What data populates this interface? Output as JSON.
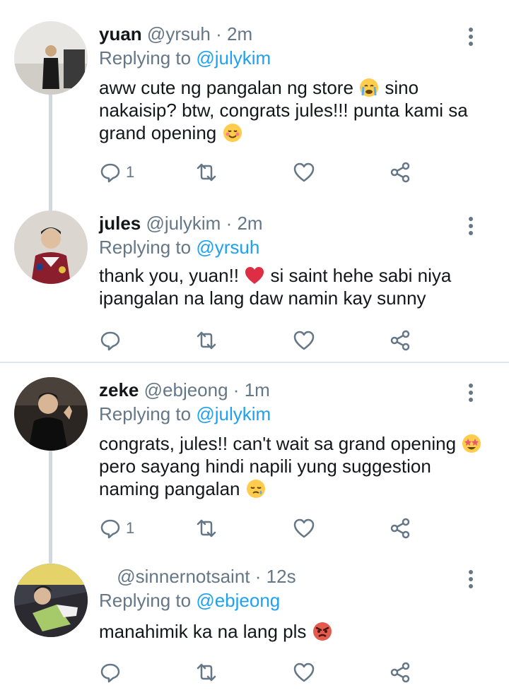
{
  "tweets": [
    {
      "display_name": "yuan",
      "handle": "@yrsuh",
      "separator": "·",
      "time": "2m",
      "replying_prefix": "Replying to",
      "replying_to": "@julykim",
      "text_parts": [
        "aww cute ng pangalan ng store",
        "sino nakaisip? btw, congrats jules!!! punta kami sa grand opening"
      ],
      "reply_count": "1"
    },
    {
      "display_name": "jules",
      "handle": "@julykim",
      "separator": "·",
      "time": "2m",
      "replying_prefix": "Replying to",
      "replying_to": "@yrsuh",
      "text_parts": [
        "thank you, yuan!!",
        "si saint hehe sabi niya ipangalan na lang daw namin kay sunny"
      ],
      "reply_count": ""
    },
    {
      "display_name": "zeke",
      "handle": "@ebjeong",
      "separator": "·",
      "time": "1m",
      "replying_prefix": "Replying to",
      "replying_to": "@julykim",
      "text_parts": [
        "congrats, jules!! can't wait sa grand opening",
        "pero sayang hindi napili yung suggestion naming pangalan"
      ],
      "reply_count": "1"
    },
    {
      "display_name": "",
      "handle": "@sinnernotsaint",
      "separator": "·",
      "time": "12s",
      "replying_prefix": "Replying to",
      "replying_to": "@ebjeong",
      "text_parts": [
        "manahimik ka na lang pls"
      ],
      "reply_count": ""
    }
  ],
  "icons": [
    "reply-icon",
    "retweet-icon",
    "like-icon",
    "share-icon",
    "more-icon"
  ],
  "colors": {
    "accent": "#1da1f2",
    "muted": "#657786",
    "text": "#14171a",
    "thread_line": "#cfd9de"
  }
}
